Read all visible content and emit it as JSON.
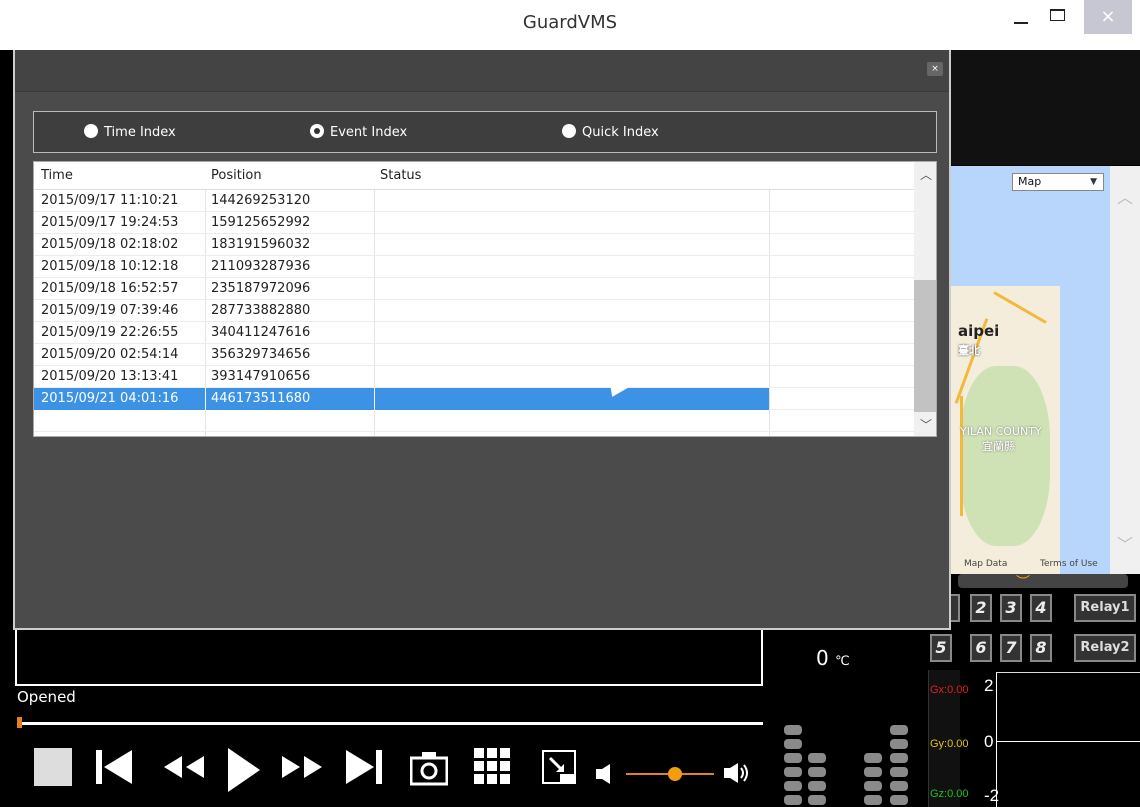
{
  "app": {
    "title": "GuardVMS"
  },
  "window_controls": {
    "minimize": "_",
    "maximize": "□",
    "close": "×"
  },
  "index_modes": [
    {
      "label": "Time Index",
      "selected": false
    },
    {
      "label": "Event Index",
      "selected": true
    },
    {
      "label": "Quick Index",
      "selected": false
    }
  ],
  "table": {
    "headers": [
      "Time",
      "Position",
      "Status"
    ],
    "rows": [
      {
        "time": "2015/09/17 11:10:21",
        "position": "144269253120",
        "status": ""
      },
      {
        "time": "2015/09/17 19:24:53",
        "position": "159125652992",
        "status": ""
      },
      {
        "time": "2015/09/18 02:18:02",
        "position": "183191596032",
        "status": ""
      },
      {
        "time": "2015/09/18 10:12:18",
        "position": "211093287936",
        "status": ""
      },
      {
        "time": "2015/09/18 16:52:57",
        "position": "235187972096",
        "status": ""
      },
      {
        "time": "2015/09/19 07:39:46",
        "position": "287733882880",
        "status": ""
      },
      {
        "time": "2015/09/19 22:26:55",
        "position": "340411247616",
        "status": ""
      },
      {
        "time": "2015/09/20 02:54:14",
        "position": "356329734656",
        "status": ""
      },
      {
        "time": "2015/09/20 13:13:41",
        "position": "393147910656",
        "status": ""
      },
      {
        "time": "2015/09/21 04:01:16",
        "position": "446173511680",
        "status": "",
        "selected": true
      }
    ]
  },
  "map": {
    "type_select": "Map",
    "label_city": "aipei",
    "label_city_zh": "臺北",
    "label_county": "YILAN COUNTY",
    "label_county_zh": "宜蘭縣",
    "footer_data": "Map Data",
    "footer_terms": "Terms of Use"
  },
  "channels": [
    "2",
    "3",
    "4",
    "5",
    "6",
    "7",
    "8"
  ],
  "relays": [
    "Relay1",
    "Relay2"
  ],
  "status": {
    "playback": "Opened",
    "temperature_value": "0",
    "temperature_unit": "℃"
  },
  "gsensor": {
    "gx": "Gx:0.00",
    "gy": "Gy:0.00",
    "gz": "Gz:0.00",
    "scale_top": "2",
    "scale_mid": "0",
    "scale_bottom": "-2"
  },
  "colors": {
    "selected_row": "#3c93e6",
    "accent": "#f39c12",
    "gx": "#e02020",
    "gy": "#e0c020",
    "gz": "#20c020"
  }
}
